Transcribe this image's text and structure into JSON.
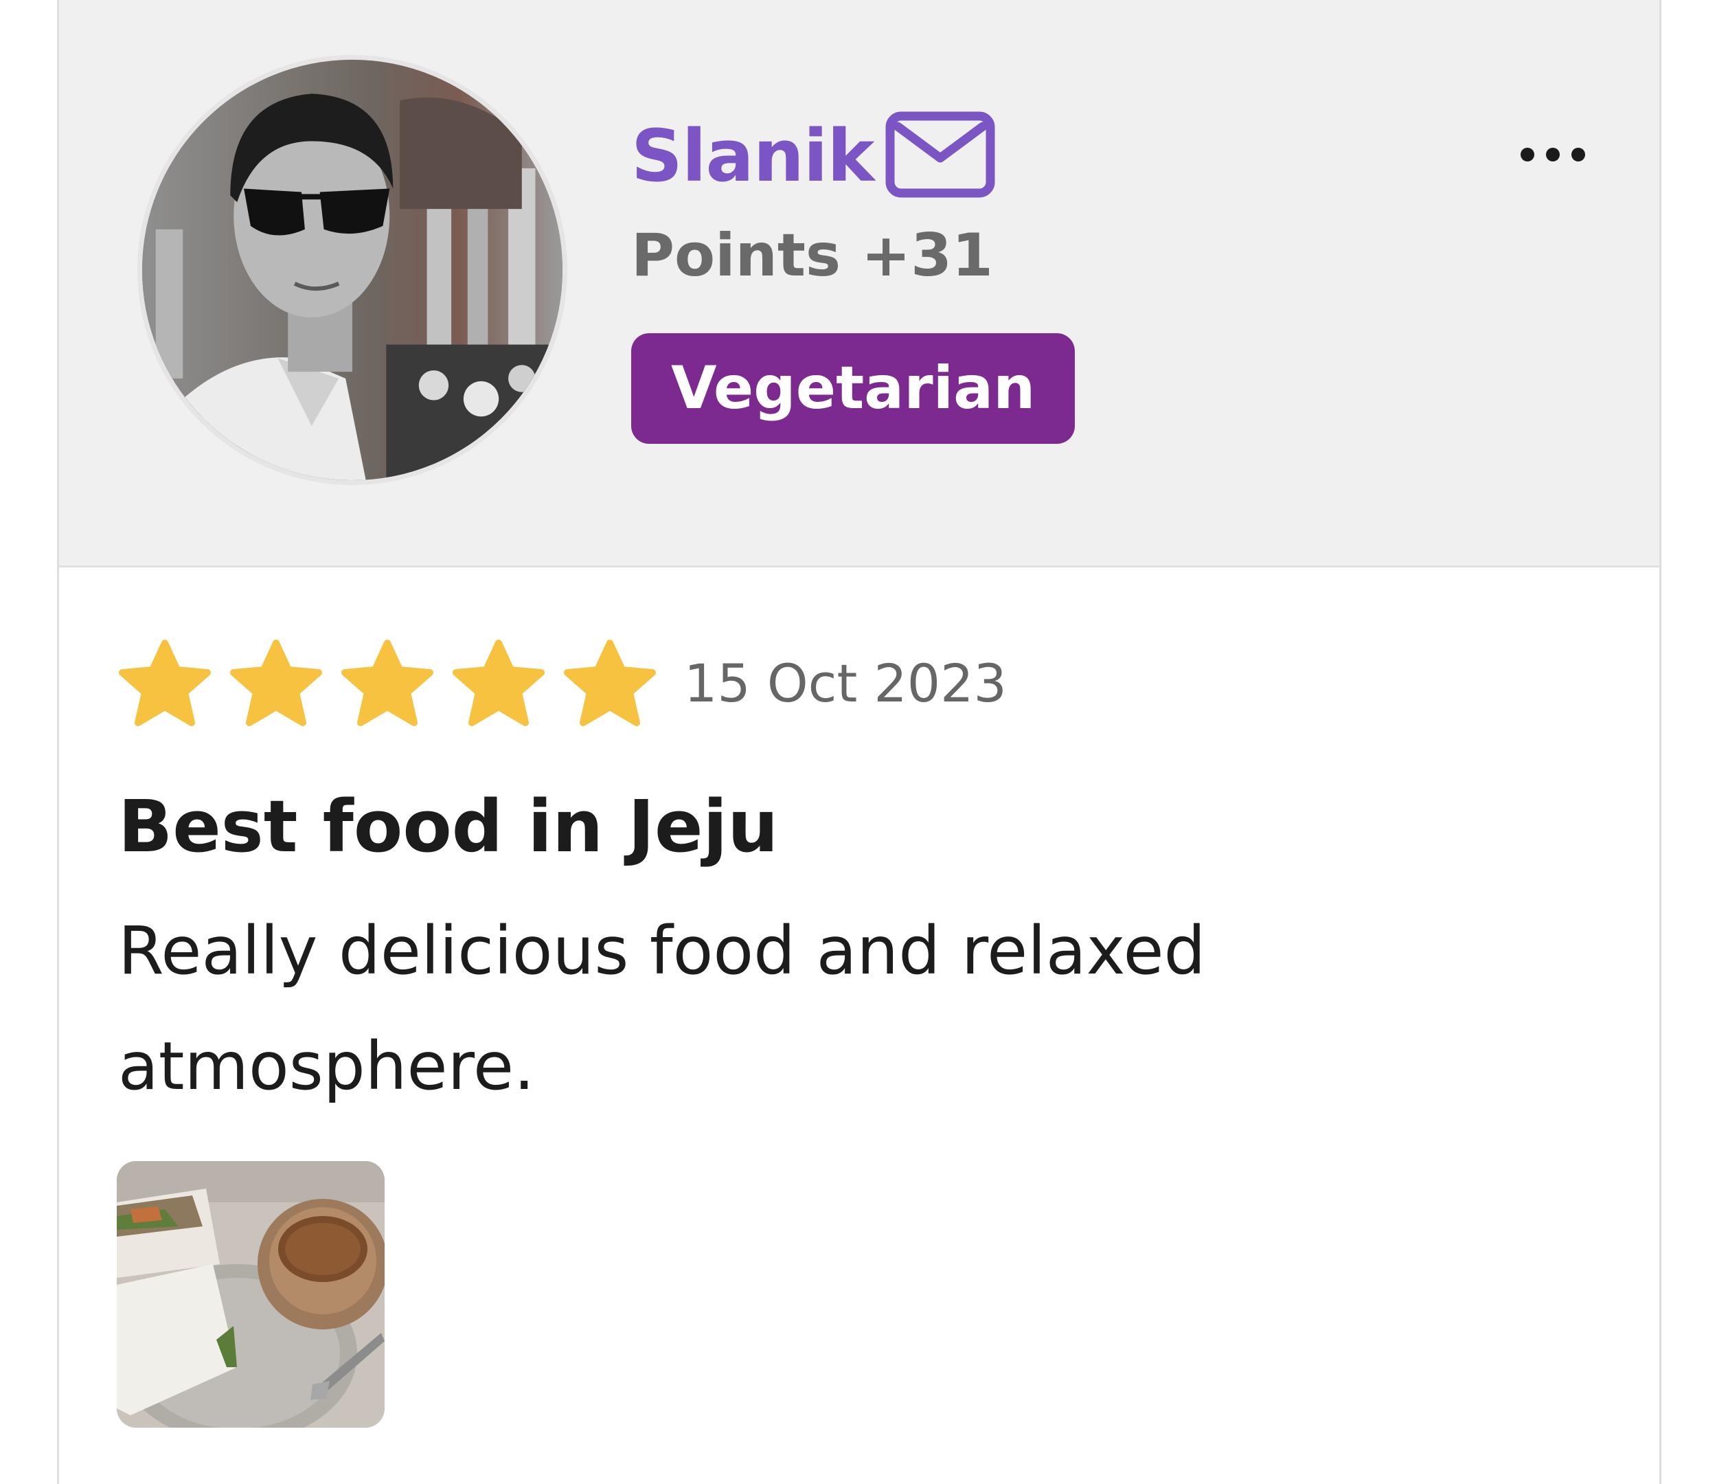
{
  "review": {
    "user": {
      "name": "Slanik",
      "points": "Points +31",
      "diet_badge": "Vegetarian",
      "avatar_icon": "user-avatar-photo",
      "message_icon": "mail-icon"
    },
    "menu_icon": "more-horizontal-icon",
    "rating": 5,
    "rating_max": 5,
    "date": "15 Oct 2023",
    "title": "Best food in Jeju",
    "body": "Really delicious food and relaxed atmosphere.",
    "photos": [
      {
        "icon": "food-photo"
      }
    ]
  },
  "colors": {
    "name": "#7b55c4",
    "badge_bg": "#7d2a90",
    "star": "#f6c240",
    "header_bg": "#f1f0f1"
  }
}
